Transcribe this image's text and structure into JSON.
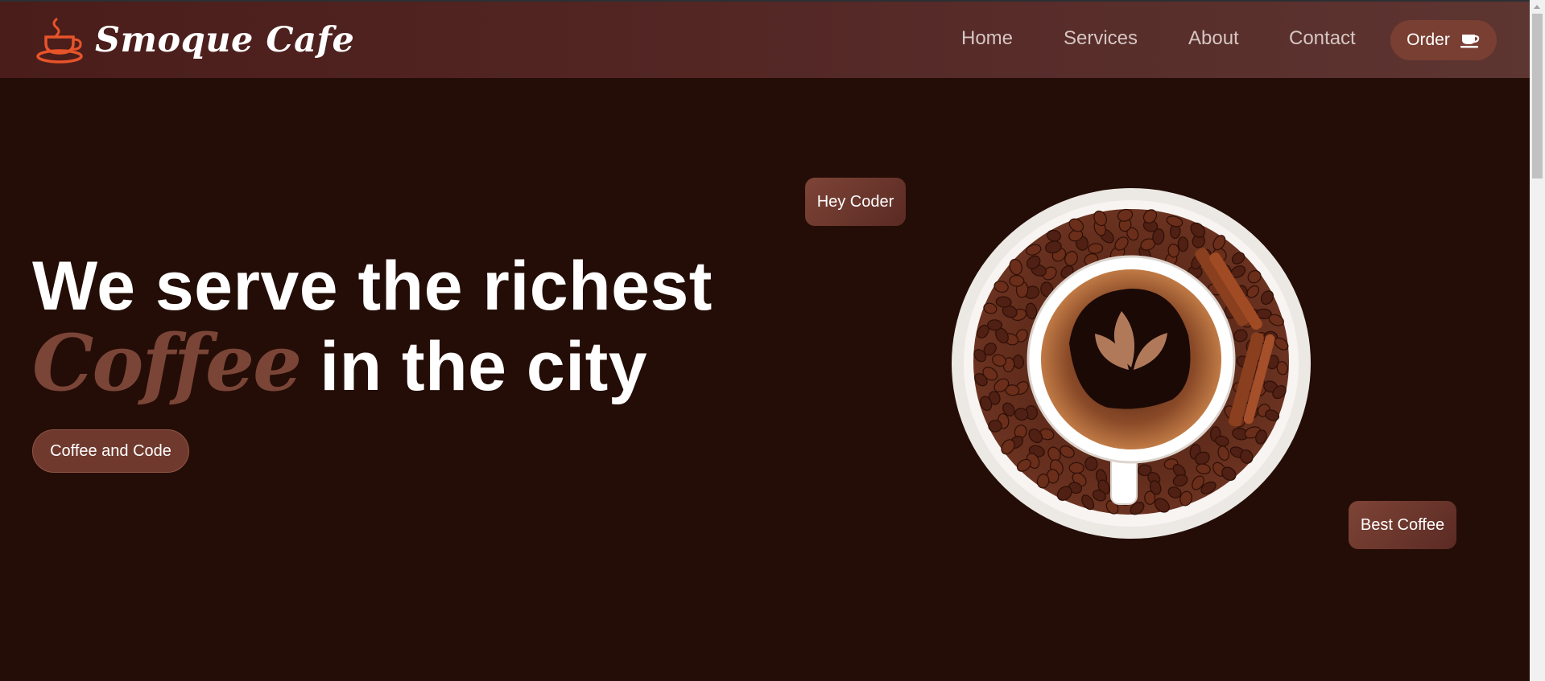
{
  "brand": {
    "name": "Smoque Cafe",
    "accent_color": "#e8542a",
    "icon": "coffee-cup-logo-icon"
  },
  "nav": {
    "items": [
      {
        "label": "Home"
      },
      {
        "label": "Services"
      },
      {
        "label": "About"
      },
      {
        "label": "Contact"
      }
    ],
    "order_button": {
      "label": "Order",
      "icon": "coffee-cup-icon"
    }
  },
  "hero": {
    "headline_line1": "We serve the richest",
    "headline_highlight": "Coffee",
    "headline_line2_rest": "in the city",
    "cta_label": "Coffee and Code",
    "tag_top": "Hey Coder",
    "tag_bottom": "Best Coffee",
    "image": "coffee-cup-on-saucer-with-beans"
  },
  "colors": {
    "background": "#240d06",
    "header": "#532624",
    "highlight": "#7a4537",
    "button": "#70392e"
  }
}
